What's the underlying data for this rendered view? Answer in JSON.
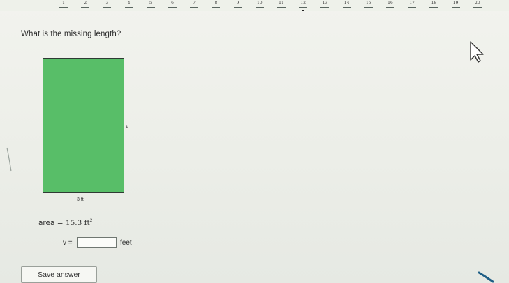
{
  "nav": {
    "items": [
      "1",
      "2",
      "3",
      "4",
      "5",
      "6",
      "7",
      "8",
      "9",
      "10",
      "11",
      "12",
      "13",
      "14",
      "15",
      "16",
      "17",
      "18",
      "19",
      "20"
    ],
    "current_index": 11
  },
  "question": {
    "prompt": "What is the missing length?"
  },
  "figure": {
    "side_label": "v",
    "width_label": "3 ft",
    "fill_color": "#58be68",
    "border_color": "#2f3a33"
  },
  "given": {
    "area_prefix": "area",
    "equals": "=",
    "area_value": "15.3 ft",
    "area_exponent": "2"
  },
  "answer": {
    "variable_label": "v =",
    "input_value": "",
    "unit_label": "feet"
  },
  "actions": {
    "save_label": "Save answer"
  },
  "icons": {
    "pointer": "mouse-pointer-icon"
  }
}
